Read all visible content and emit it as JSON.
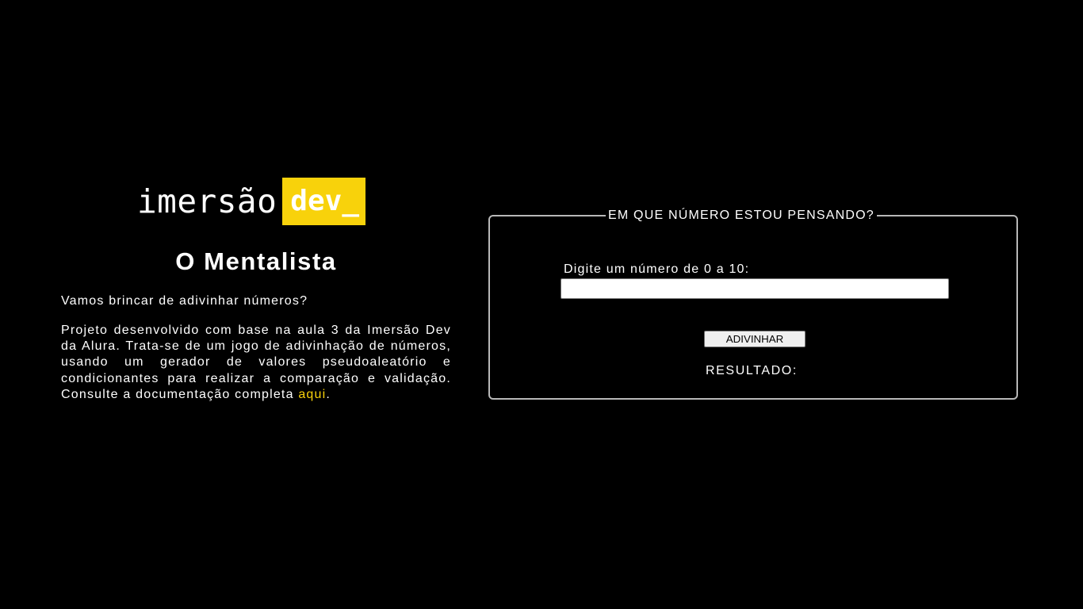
{
  "logo": {
    "word": "imersão",
    "badge": "dev_",
    "accent_color": "#f8d20b"
  },
  "main": {
    "title": "O Mentalista",
    "intro": "Vamos brincar de adivinhar números?",
    "description": "Projeto desenvolvido com base na aula 3 da Imersão Dev da Alura. Trata-se de um jogo de adivinhação de números, usando um gerador de valores pseudoaleatório e condicionantes para realizar a comparação e validação. Consulte a documentação completa ",
    "link_label": "aqui",
    "description_end": "."
  },
  "game": {
    "legend": "EM QUE NÚMERO ESTOU PENSANDO?",
    "input_label": "Digite um número de 0 a 10:",
    "input_value": "",
    "button_label": "ADIVINHAR",
    "result_label": "RESULTADO:"
  }
}
